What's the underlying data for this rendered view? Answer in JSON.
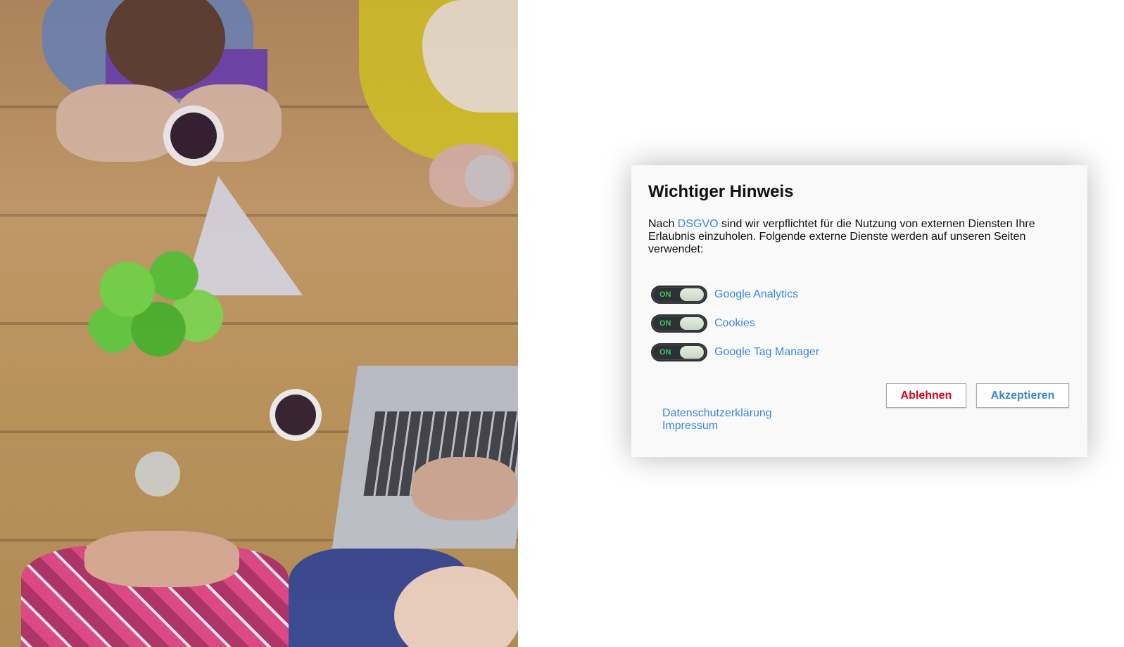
{
  "dialog": {
    "title": "Wichtiger Hinweis",
    "intro_before": "Nach ",
    "intro_link": "DSGVO",
    "intro_after": " sind wir verpflichtet für die Nutzung von externen Diensten Ihre Erlaubnis einzuholen. Folgende externe Dienste werden auf unseren Seiten verwendet:",
    "services": [
      {
        "toggle_label": "ON",
        "name": "Google Analytics"
      },
      {
        "toggle_label": "ON",
        "name": "Cookies"
      },
      {
        "toggle_label": "ON",
        "name": "Google Tag Manager"
      }
    ],
    "buttons": {
      "decline": "Ablehnen",
      "accept": "Akzeptieren"
    },
    "links": {
      "privacy": "Datenschutzerklärung",
      "imprint": "Impressum"
    }
  },
  "colors": {
    "link": "#3a87d8",
    "decline": "#d8001a",
    "toggle_on_text": "#3ec95c",
    "toggle_track": "#2d3136",
    "dialog_bg": "#f9f9f9"
  },
  "icons": {
    "toggle": "switch-toggle-icon"
  }
}
